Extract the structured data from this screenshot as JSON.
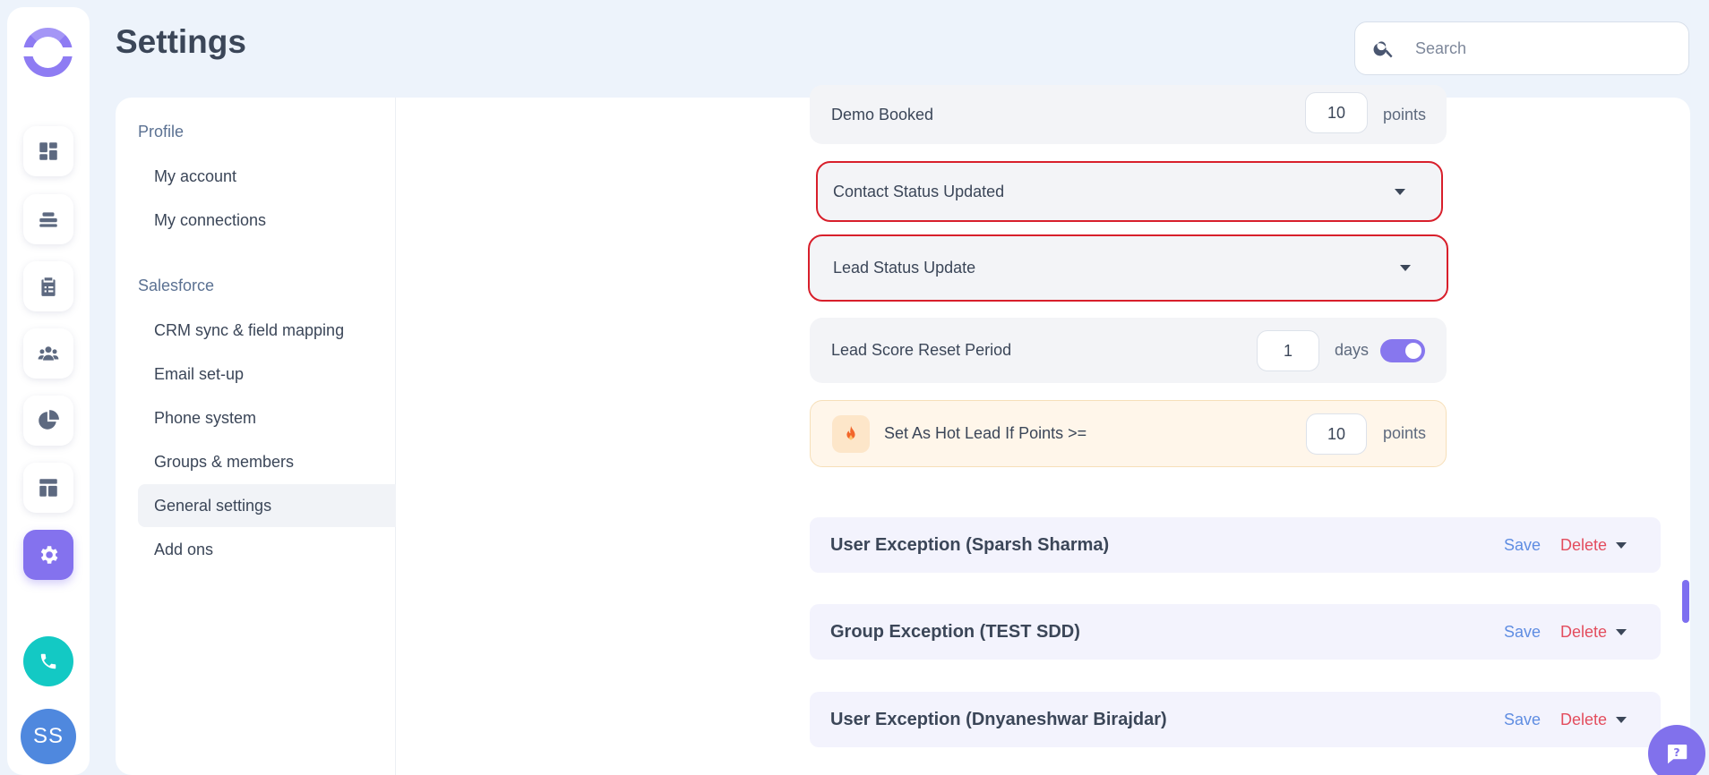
{
  "header": {
    "title": "Settings",
    "search_placeholder": "Search"
  },
  "rail": {
    "items": [
      "dashboard-icon",
      "layers-icon",
      "clipboard-icon",
      "team-icon",
      "pie-chart-icon",
      "layout-icon",
      "gear-icon"
    ],
    "active": "gear-icon",
    "avatar_initials": "SS",
    "accent": "#8472ee",
    "phone_color": "#13c9c4"
  },
  "subnav": {
    "sections": [
      {
        "title": "Profile",
        "items": [
          "My account",
          "My connections"
        ]
      },
      {
        "title": "Salesforce",
        "items": [
          "CRM sync & field mapping",
          "Email set-up",
          "Phone system",
          "Groups & members",
          "General settings",
          "Add ons"
        ]
      }
    ],
    "active_item": "General settings"
  },
  "scoring": {
    "demo_booked": {
      "label": "Demo Booked",
      "value": "10",
      "unit": "points"
    },
    "contact_status": {
      "label": "Contact Status Updated"
    },
    "lead_status": {
      "label": "Lead Status Update"
    },
    "reset_period": {
      "label": "Lead Score Reset Period",
      "value": "1",
      "unit": "days",
      "enabled": true
    },
    "hot_lead": {
      "label": "Set As Hot Lead If Points >=",
      "value": "10",
      "unit": "points"
    }
  },
  "exceptions": [
    {
      "title": "User Exception (Sparsh Sharma)",
      "save": "Save",
      "delete": "Delete"
    },
    {
      "title": "Group Exception (TEST SDD)",
      "save": "Save",
      "delete": "Delete"
    },
    {
      "title": "User Exception (Dnyaneshwar Birajdar)",
      "save": "Save",
      "delete": "Delete"
    }
  ]
}
